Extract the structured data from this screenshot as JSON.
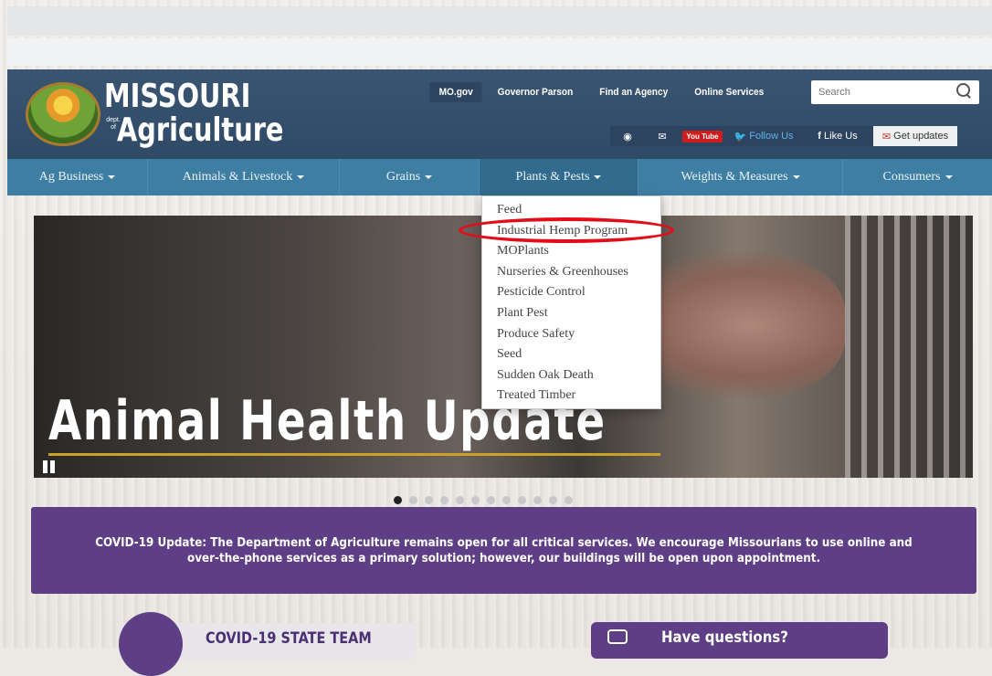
{
  "logo": {
    "title": "MISSOURI",
    "dept": "dept. of",
    "subtitle": "Agriculture"
  },
  "top_links": [
    "MO.gov",
    "Governor Parson",
    "Find an Agency",
    "Online Services"
  ],
  "search": {
    "placeholder": "Search"
  },
  "social": {
    "youtube": "You Tube",
    "twitter": "Follow Us",
    "facebook": "Like Us",
    "updates": "Get updates"
  },
  "nav": [
    {
      "label": "Ag Business"
    },
    {
      "label": "Animals & Livestock"
    },
    {
      "label": "Grains"
    },
    {
      "label": "Plants & Pests"
    },
    {
      "label": "Weights & Measures"
    },
    {
      "label": "Consumers"
    }
  ],
  "dropdown": [
    "Feed",
    "Industrial Hemp Program",
    "MOPlants",
    "Nurseries & Greenhouses",
    "Pesticide Control",
    "Plant Pest",
    "Produce Safety",
    "Seed",
    "Sudden Oak Death",
    "Treated Timber"
  ],
  "banner": {
    "title": "Animal Health Update"
  },
  "carousel": {
    "slides": 12,
    "active": 1
  },
  "covid_notice": "COVID-19 Update: The Department of Agriculture remains open for all critical services. We encourage Missourians to use online and over-the-phone services as a primary solution; however, our buildings will be open upon appointment.",
  "buttons": {
    "state_team": "COVID-19 STATE TEAM",
    "questions": "Have questions?"
  },
  "colors": {
    "header": "#2f4a67",
    "nav": "#3e7ea2",
    "purple": "#5e3f86",
    "highlight": "#e30d1a"
  }
}
